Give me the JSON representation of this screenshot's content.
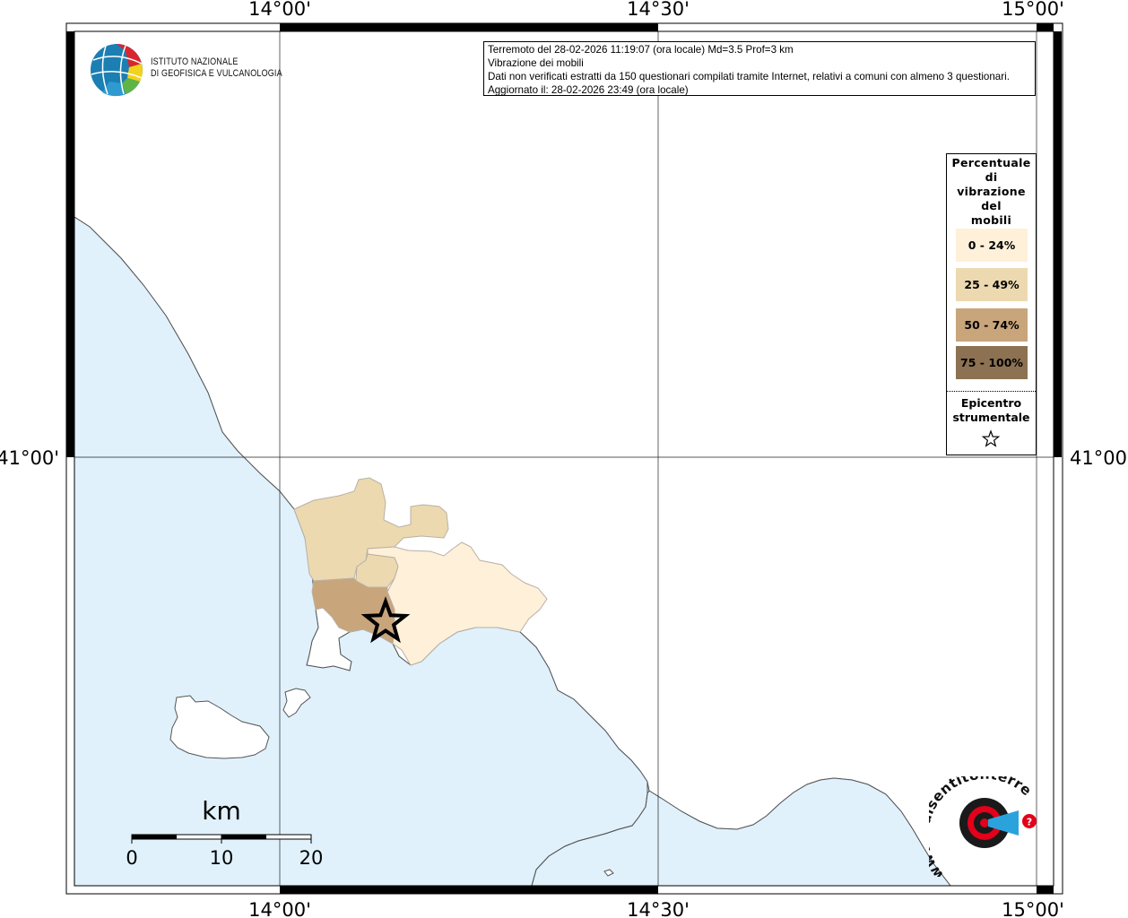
{
  "axes": {
    "top_labels": [
      "14°00'",
      "14°30'",
      "15°00'"
    ],
    "bottom_labels": [
      "14°00'",
      "14°30'",
      "15°00'"
    ],
    "left_labels": [
      "41°00'"
    ],
    "right_labels": [
      "41°00'"
    ]
  },
  "info": {
    "line1": "Terremoto del 28-02-2026 11:19:07 (ora locale) Md=3.5 Prof=3 km",
    "line2": "Vibrazione dei mobili",
    "line3": "Dati non verificati estratti da 150 questionari compilati tramite Internet, relativi a comuni con almeno 3 questionari.",
    "line4": "Aggiornato il: 28-02-2026 23:49 (ora locale)"
  },
  "logo": {
    "line1": "ISTITUTO NAZIONALE",
    "line2": "DI GEOFISICA E VULCANOLOGIA"
  },
  "legend": {
    "title": "Percentuale\ndi\nvibrazione\ndel\nmobili",
    "classes": [
      {
        "label": "0 - 24%",
        "color": "#fef0d9"
      },
      {
        "label": "25 - 49%",
        "color": "#ecd9b0"
      },
      {
        "label": "50 - 74%",
        "color": "#c8a57b"
      },
      {
        "label": "75 - 100%",
        "color": "#8c7152"
      }
    ],
    "epicenter_label": "Epicentro\nstrumentale"
  },
  "scalebar": {
    "title": "km",
    "ticks": [
      "0",
      "10",
      "20"
    ]
  },
  "watermark": {
    "text": "www.haisentitoilterremoto.it",
    "accent_color": "#e2001a"
  },
  "colors": {
    "sea": "#e0f1fc",
    "land": "#ffffff",
    "coast": "#555555"
  }
}
